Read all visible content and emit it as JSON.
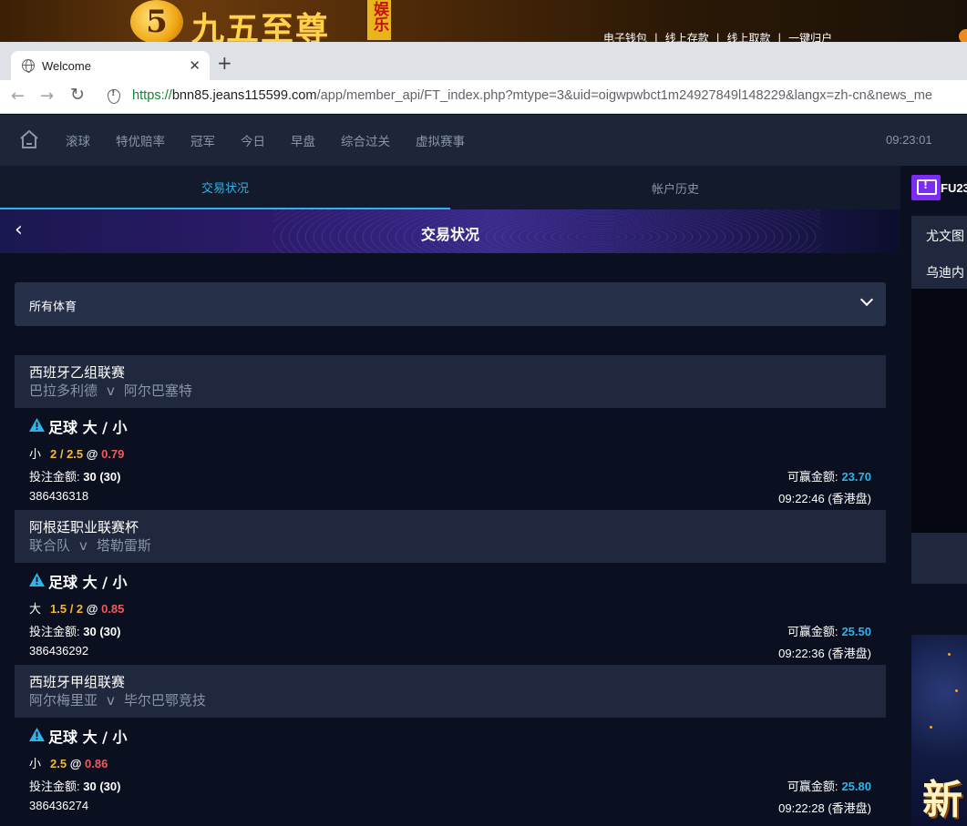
{
  "banner": {
    "logo_glyph": "5",
    "title": "九五至尊",
    "tag": "娱乐",
    "links": [
      "电子钱包",
      "|",
      "线上存款",
      "|",
      "线上取款",
      "|",
      "一键归户"
    ]
  },
  "browser": {
    "tab_title": "Welcome",
    "tab_close": "✕",
    "new_tab": "+",
    "url_scheme": "https://",
    "url_host": "bnn85.jeans115599.com",
    "url_path": "/app/member_api/FT_index.php?mtype=3&uid=oigwpwbct1m24927849l148229&langx=zh-cn&news_me"
  },
  "nav": {
    "items": [
      "滚球",
      "特优赔率",
      "冠军",
      "今日",
      "早盘",
      "综合过关",
      "虚拟赛事"
    ],
    "time": "09:23:01"
  },
  "subtabs": {
    "active": "交易状况",
    "inactive": "帐户历史"
  },
  "hero": {
    "back": "‹",
    "title": "交易状况"
  },
  "filter": {
    "label": "所有体育"
  },
  "bets": [
    {
      "league": "西班牙乙组联赛",
      "home": "巴拉多利德",
      "v": "v",
      "away": "阿尔巴塞特",
      "market": "足球 大 / 小",
      "side": "小",
      "handicap": "2 / 2.5",
      "at": "@",
      "odds": "0.79",
      "stake_label": "投注金额:",
      "stake": "30 (30)",
      "win_label": "可赢金额:",
      "win": "23.70",
      "ticket": "386436318",
      "time": "09:22:46 (香港盘)"
    },
    {
      "league": "阿根廷职业联赛杯",
      "home": "联合队",
      "v": "v",
      "away": "塔勒雷斯",
      "market": "足球 大 / 小",
      "side": "大",
      "handicap": "1.5 / 2",
      "at": "@",
      "odds": "0.85",
      "stake_label": "投注金额:",
      "stake": "30 (30)",
      "win_label": "可赢金额:",
      "win": "25.50",
      "ticket": "386436292",
      "time": "09:22:36 (香港盘)"
    },
    {
      "league": "西班牙甲组联赛",
      "home": "阿尔梅里亚",
      "v": "v",
      "away": "毕尔巴鄂竞技",
      "market": "足球 大 / 小",
      "side": "小",
      "handicap": "2.5",
      "at": "@",
      "odds": "0.86",
      "stake_label": "投注金额:",
      "stake": "30 (30)",
      "win_label": "可赢金额:",
      "win": "25.80",
      "ticket": "386436274",
      "time": "09:22:28 (香港盘)"
    }
  ],
  "side_panel": {
    "code": "FU23",
    "items": [
      "尤文图",
      "乌迪内"
    ],
    "promo_text": "新"
  },
  "colors": {
    "accent": "#2fb3e8",
    "handicap": "#f7b733",
    "odds": "#f05a5a",
    "panel": "#1f283d",
    "background": "#0b1020"
  }
}
